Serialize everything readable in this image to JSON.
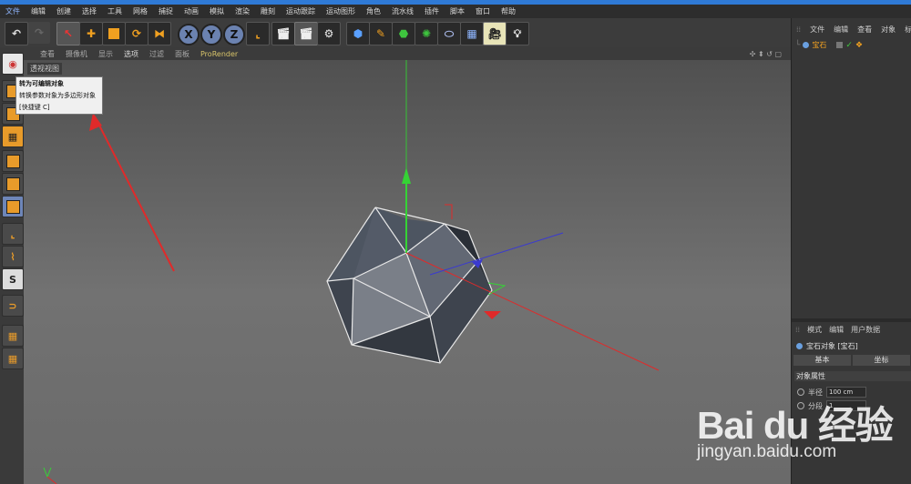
{
  "menubar": {
    "items": [
      "文件",
      "编辑",
      "创建",
      "选择",
      "工具",
      "网格",
      "捕捉",
      "动画",
      "模拟",
      "渲染",
      "雕刻",
      "运动跟踪",
      "运动图形",
      "角色",
      "流水线",
      "插件",
      "脚本",
      "窗口",
      "帮助"
    ]
  },
  "toolbar": {
    "x_label": "X",
    "y_label": "Y",
    "z_label": "Z"
  },
  "viewport": {
    "menu": [
      "查看",
      "摄像机",
      "显示",
      "选项",
      "过滤",
      "面板"
    ],
    "prorender": "ProRender",
    "label": "透视视图",
    "nav_icons": "✣ ⬍ ↺ ▢"
  },
  "tooltip": {
    "title": "转为可编辑对象",
    "desc": "转换参数对象为多边形对象",
    "shortcut": "[快捷键 C]"
  },
  "object_manager": {
    "menu": [
      "文件",
      "编辑",
      "查看",
      "对象",
      "标签"
    ],
    "object_name": "宝石"
  },
  "attributes": {
    "menu": [
      "模式",
      "编辑",
      "用户数据"
    ],
    "title": "宝石对象 [宝石]",
    "tabs": [
      "基本",
      "坐标"
    ],
    "section": "对象属性",
    "radius_label": "半径",
    "radius_value": "100 cm",
    "segments_label": "分段",
    "segments_value": "1"
  },
  "watermark": {
    "logo": "Bai du 经验",
    "url": "jingyan.baidu.com"
  }
}
